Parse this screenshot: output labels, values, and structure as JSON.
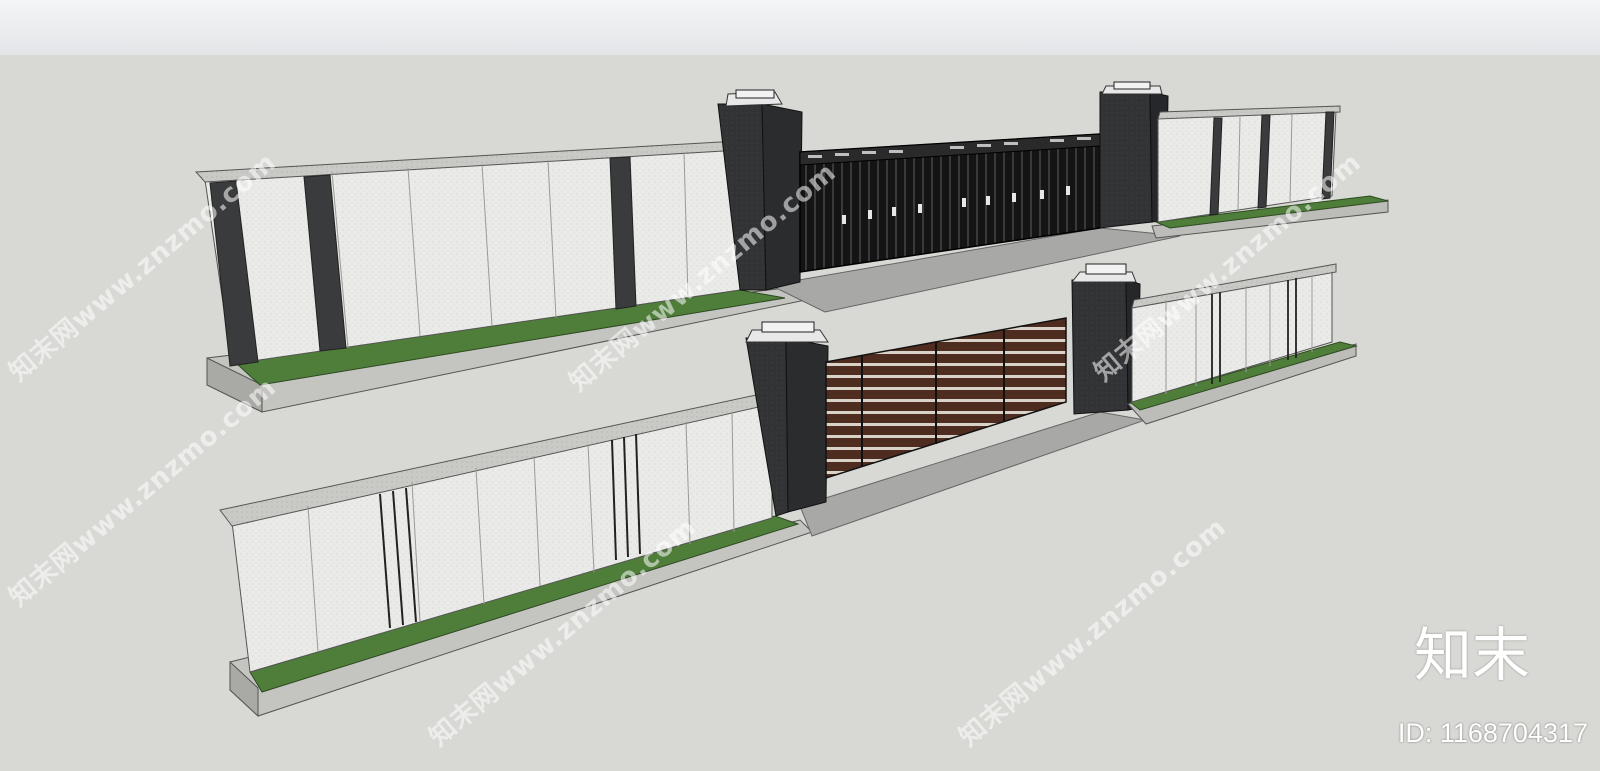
{
  "watermark": {
    "site_text": "知末网www.znzmo.com",
    "logo_text": "知末",
    "id_text": "ID: 1168704317"
  },
  "colors": {
    "sky": "#eef0f2",
    "ground": "#d8d8d4",
    "stone_light": "#ececea",
    "stone_cap": "#c8c8c4",
    "pillar_dark": "#2f3032",
    "grass": "#4f7d3a",
    "gate_black": "#1b1b1b",
    "gate_wood": "#5b3324"
  }
}
